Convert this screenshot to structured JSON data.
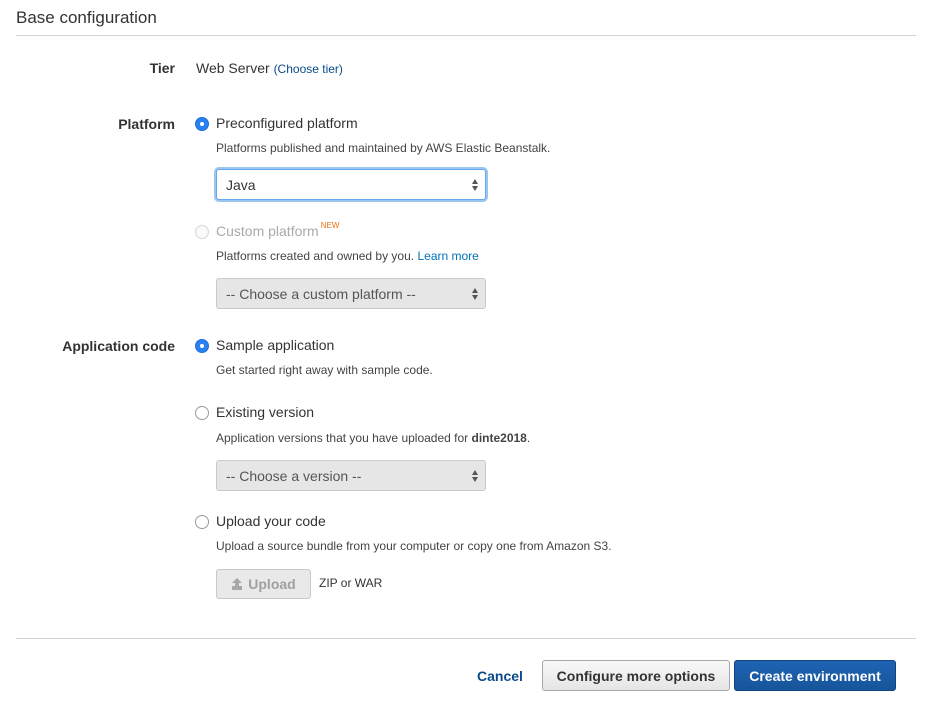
{
  "section": {
    "title": "Base configuration"
  },
  "tier": {
    "label": "Tier",
    "value": "Web Server",
    "link": "(Choose tier)"
  },
  "platform": {
    "label": "Platform",
    "preconfigured": {
      "label": "Preconfigured platform",
      "help": "Platforms published and maintained by AWS Elastic Beanstalk.",
      "selected_value": "Java",
      "checked": true
    },
    "custom": {
      "label": "Custom platform",
      "badge": "NEW",
      "help": "Platforms created and owned by you.",
      "help_link": "Learn more",
      "placeholder": "-- Choose a custom platform --",
      "enabled": false
    }
  },
  "application_code": {
    "label": "Application code",
    "sample": {
      "label": "Sample application",
      "help": "Get started right away with sample code.",
      "checked": true
    },
    "existing": {
      "label": "Existing version",
      "help_prefix": "Application versions that you have uploaded for ",
      "app_name": "dinte2018",
      "help_suffix": ".",
      "placeholder": "-- Choose a version --"
    },
    "upload": {
      "label": "Upload your code",
      "help": "Upload a source bundle from your computer or copy one from Amazon S3.",
      "button_label": "Upload",
      "formats": "ZIP or WAR"
    }
  },
  "footer": {
    "cancel_label": "Cancel",
    "configure_label": "Configure more options",
    "create_label": "Create environment"
  },
  "colors": {
    "radio_checked": "#2a7ff3",
    "link": "#0073bb",
    "new_badge": "#ec7211",
    "primary_button": "#1f63b4"
  }
}
